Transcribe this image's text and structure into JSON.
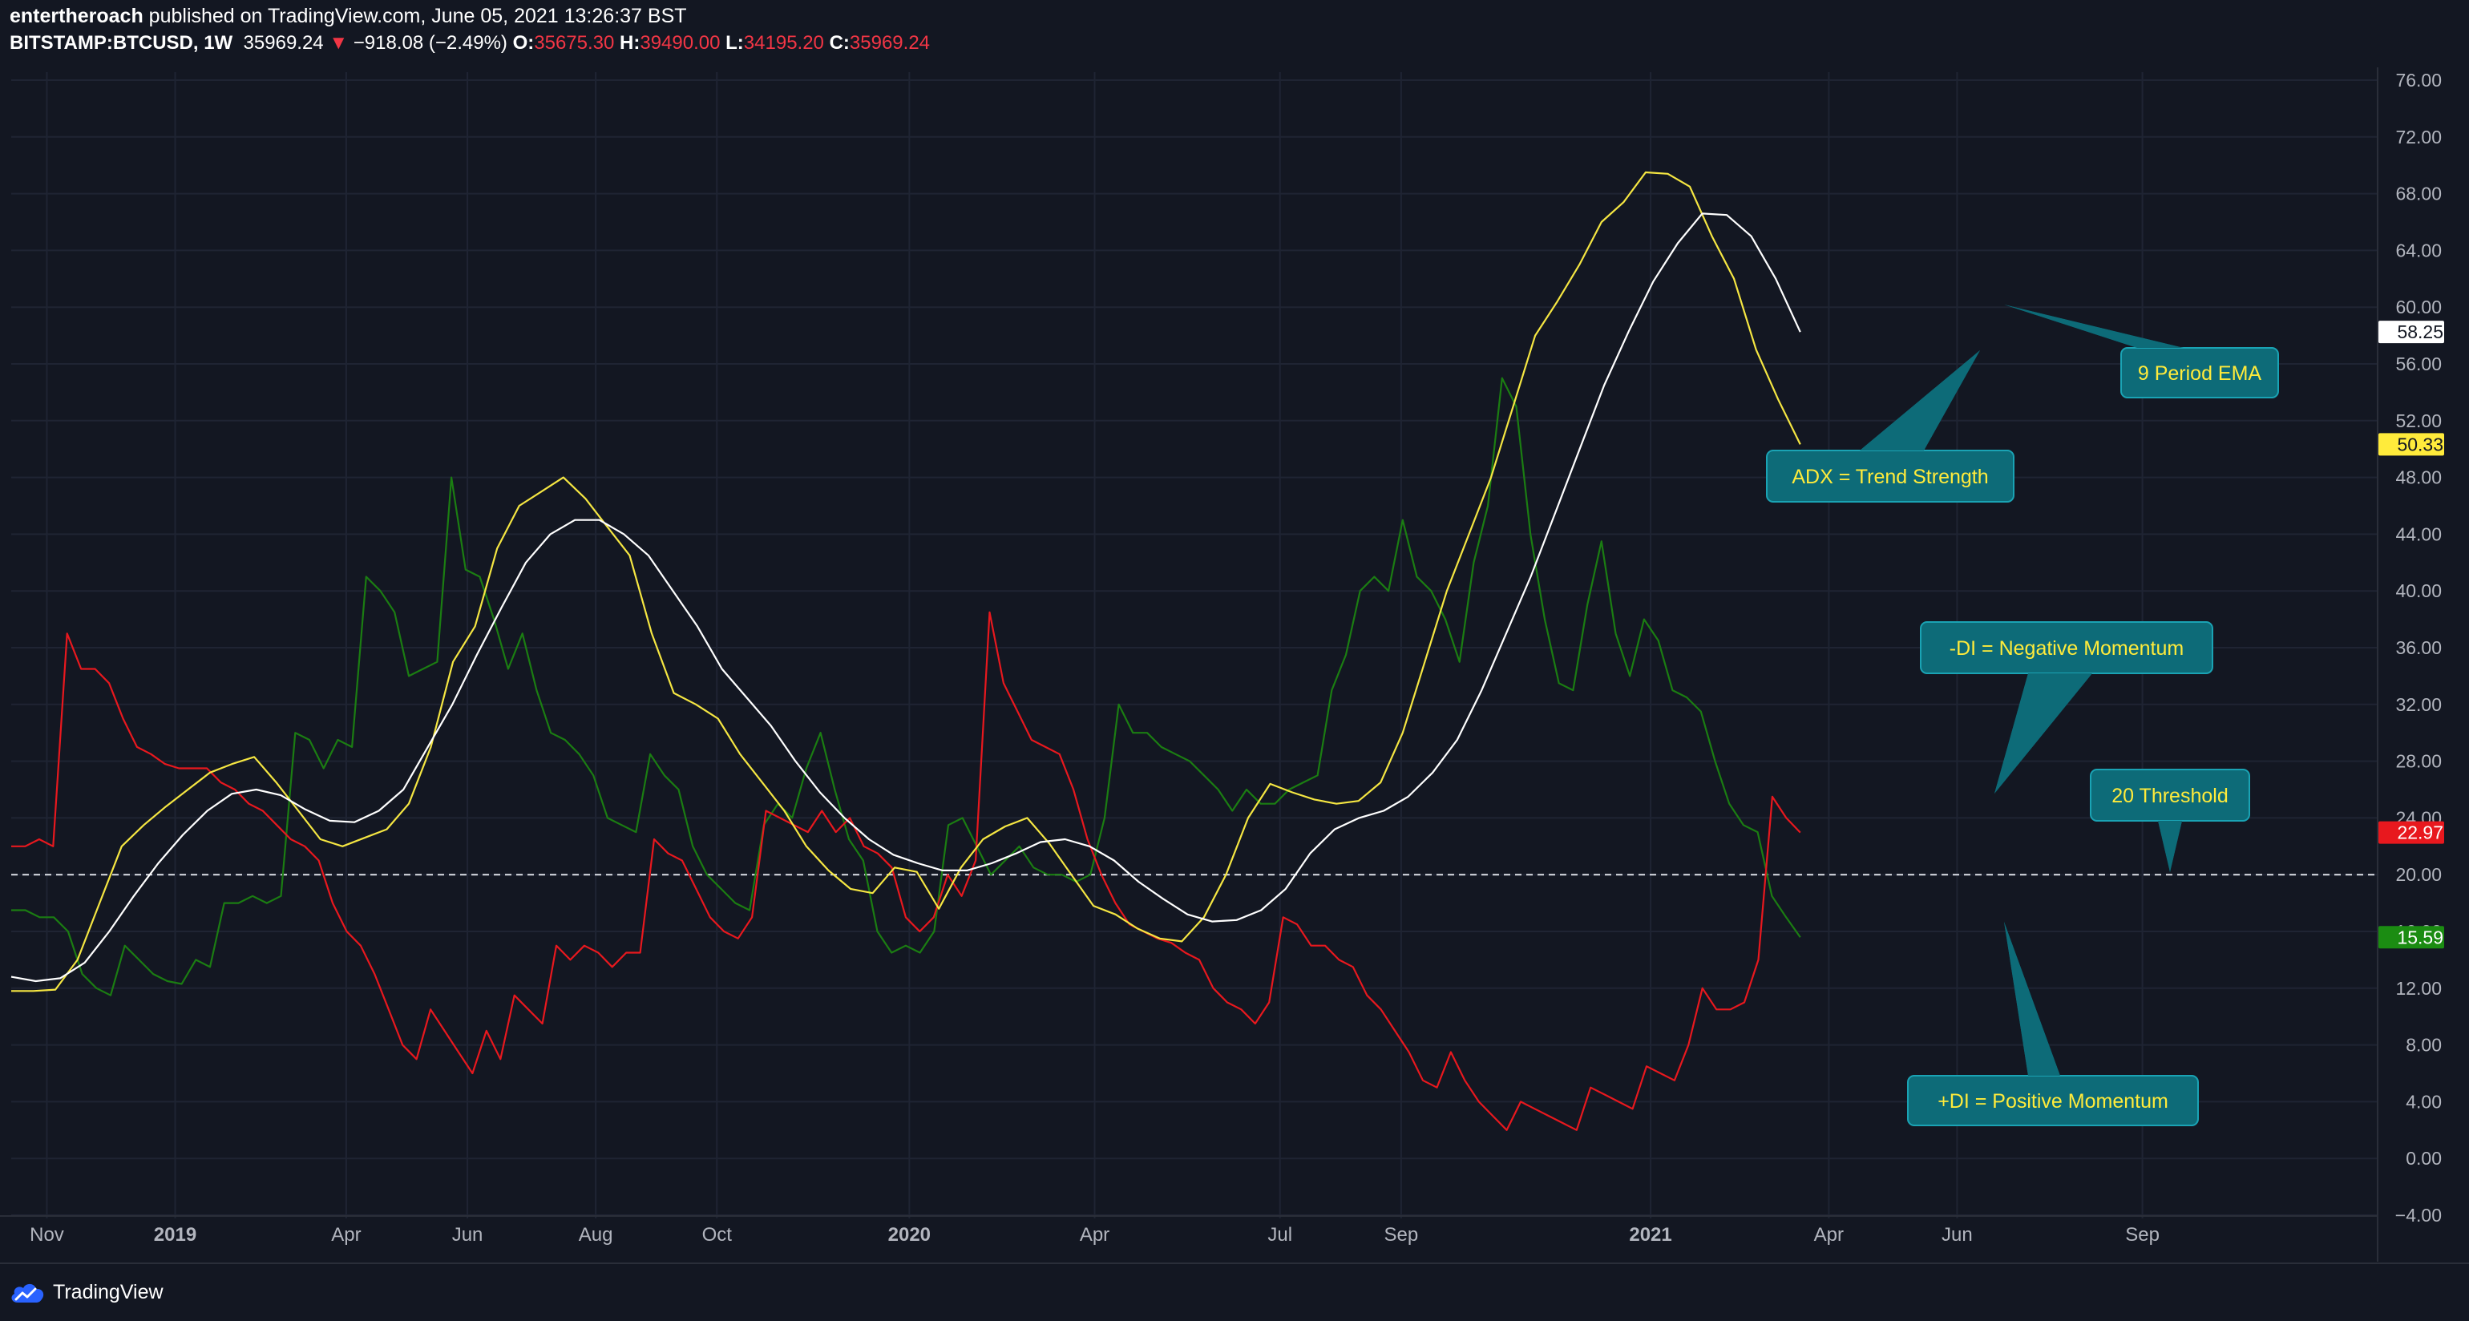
{
  "header": {
    "author": "entertheroach",
    "published_text": "published on TradingView.com, June 05, 2021 13:26:37 BST",
    "symbol": "BITSTAMP:BTCUSD, 1W",
    "last_price": "35969.24",
    "change_arrow": "▼",
    "change": "−918.08 (−2.49%)",
    "open_label": "O:",
    "open": "35675.30",
    "high_label": "H:",
    "high": "39490.00",
    "low_label": "L:",
    "low": "34195.20",
    "close_label": "C:",
    "close": "35969.24"
  },
  "brand": {
    "label": "TradingView"
  },
  "colors": {
    "background": "#131722",
    "grid": "#1f2433",
    "adx": "#f5e642",
    "ema": "#ffffff",
    "minus_di": "#e8181e",
    "plus_di": "#1b7d12",
    "annotation_bg": "#0d6b78",
    "annotation_border": "#1aa3b4",
    "annotation_text": "#ffeb3b"
  },
  "chart_data": {
    "type": "line",
    "ylim": [
      -4,
      76
    ],
    "xlim": [
      0,
      166
    ],
    "y_ticks": [
      "76.00",
      "72.00",
      "68.00",
      "64.00",
      "60.00",
      "56.00",
      "52.00",
      "48.00",
      "44.00",
      "40.00",
      "36.00",
      "32.00",
      "28.00",
      "24.00",
      "20.00",
      "16.00",
      "12.00",
      "8.00",
      "4.00",
      "0.00",
      "−4.00"
    ],
    "x_ticks": [
      {
        "x": 2.5,
        "label": "Nov",
        "bold": false
      },
      {
        "x": 11.5,
        "label": "2019",
        "bold": true
      },
      {
        "x": 23.5,
        "label": "Apr",
        "bold": false
      },
      {
        "x": 32,
        "label": "Jun",
        "bold": false
      },
      {
        "x": 41,
        "label": "Aug",
        "bold": false
      },
      {
        "x": 49.5,
        "label": "Oct",
        "bold": false
      },
      {
        "x": 63,
        "label": "2020",
        "bold": true
      },
      {
        "x": 76,
        "label": "Apr",
        "bold": false
      },
      {
        "x": 89,
        "label": "Jul",
        "bold": false
      },
      {
        "x": 97.5,
        "label": "Sep",
        "bold": false
      },
      {
        "x": 115,
        "label": "2021",
        "bold": true
      },
      {
        "x": 127.5,
        "label": "Apr",
        "bold": false
      },
      {
        "x": 136.5,
        "label": "Jun",
        "bold": false
      },
      {
        "x": 149.5,
        "label": "Sep",
        "bold": false
      }
    ],
    "threshold": 20,
    "series": [
      {
        "name": "ADX",
        "key": "adx",
        "last_label": "50.33",
        "values": [
          11.8,
          11.8,
          11.9,
          14,
          18,
          22,
          23.5,
          24.8,
          26,
          27.2,
          27.8,
          28.3,
          26.5,
          24.5,
          22.5,
          22,
          22.6,
          23.2,
          25,
          29,
          35,
          37.5,
          43,
          46,
          47,
          48,
          46.5,
          44.5,
          42.5,
          37,
          32.8,
          32,
          31,
          28.5,
          26.5,
          24.5,
          22,
          20.3,
          19,
          18.7,
          20.5,
          20.2,
          17.6,
          20.5,
          22.5,
          23.4,
          24,
          22.2,
          20,
          17.8,
          17.2,
          16.2,
          15.5,
          15.3,
          17,
          20,
          24,
          26.4,
          25.8,
          25.3,
          25,
          25.2,
          26.5,
          30,
          35,
          40,
          44,
          48,
          53,
          58,
          60.4,
          63,
          66,
          67.4,
          69.5,
          69.4,
          68.5,
          65,
          62,
          57,
          53.5,
          50.33
        ]
      },
      {
        "name": "EMA",
        "key": "ema",
        "last_label": "58.25",
        "values": [
          12.8,
          12.5,
          12.7,
          13.8,
          16,
          18.5,
          20.8,
          22.8,
          24.5,
          25.7,
          26,
          25.6,
          24.6,
          23.8,
          23.7,
          24.5,
          26,
          29,
          32,
          35.5,
          38.8,
          42,
          44,
          45,
          45,
          44,
          42.5,
          40,
          37.5,
          34.5,
          32.5,
          30.5,
          28,
          25.8,
          24,
          22.5,
          21.4,
          20.8,
          20.3,
          20.3,
          20.8,
          21.5,
          22.3,
          22.5,
          22,
          21,
          19.5,
          18.3,
          17.2,
          16.7,
          16.8,
          17.5,
          19,
          21.5,
          23.2,
          24,
          24.5,
          25.5,
          27.2,
          29.5,
          33,
          37,
          41,
          45.5,
          50,
          54.5,
          58.3,
          61.8,
          64.5,
          66.6,
          66.5,
          65,
          62,
          58.25
        ]
      },
      {
        "name": "-DI",
        "key": "minus_di",
        "last_label": "22.97",
        "values": [
          22,
          22,
          22.5,
          22,
          37,
          34.5,
          34.5,
          33.5,
          31,
          29,
          28.5,
          27.8,
          27.5,
          27.5,
          27.5,
          26.5,
          26,
          25,
          24.5,
          23.5,
          22.5,
          22,
          21,
          18,
          16,
          15,
          13,
          10.5,
          8,
          7,
          10.5,
          9,
          7.5,
          6,
          9,
          7,
          11.5,
          10.5,
          9.5,
          15,
          14,
          15,
          14.5,
          13.5,
          14.5,
          14.5,
          22.5,
          21.5,
          21,
          19,
          17,
          16,
          15.5,
          17,
          24.5,
          24,
          23.5,
          23,
          24.5,
          23,
          24,
          22,
          21.5,
          20.5,
          17,
          16,
          17,
          20,
          18.5,
          21,
          38.5,
          33.5,
          31.5,
          29.5,
          29,
          28.5,
          26,
          22.5,
          20,
          18,
          16.5,
          16,
          15.5,
          15.2,
          14.5,
          14,
          12,
          11,
          10.5,
          9.5,
          11,
          17,
          16.5,
          15,
          15,
          14,
          13.5,
          11.5,
          10.5,
          9,
          7.5,
          5.5,
          5,
          7.5,
          5.5,
          4,
          3,
          2,
          4,
          3.5,
          3,
          2.5,
          2,
          5,
          4.5,
          4,
          3.5,
          6.5,
          6,
          5.5,
          8,
          12,
          10.5,
          10.5,
          11,
          14,
          25.5,
          24,
          22.97
        ]
      },
      {
        "name": "+DI",
        "key": "plus_di",
        "last_label": "15.59",
        "values": [
          17.5,
          17.5,
          17,
          17,
          16,
          13,
          12,
          11.5,
          15,
          14,
          13,
          12.5,
          12.3,
          14,
          13.5,
          18,
          18,
          18.5,
          18,
          18.5,
          30,
          29.5,
          27.5,
          29.5,
          29,
          41,
          40,
          38.5,
          34,
          34.5,
          35,
          48,
          41.5,
          41,
          38,
          34.5,
          37,
          33,
          30,
          29.5,
          28.5,
          27,
          24,
          23.5,
          23,
          28.5,
          27,
          26,
          22,
          20,
          19,
          18,
          17.5,
          23.5,
          25,
          24,
          27.5,
          30,
          26,
          22.5,
          21,
          16,
          14.5,
          15,
          14.5,
          16,
          23.5,
          24,
          22,
          20,
          21,
          22,
          20.5,
          20,
          20,
          19.5,
          20,
          24,
          32,
          30,
          30,
          29,
          28.5,
          28,
          27,
          26,
          24.5,
          26,
          25,
          25,
          26,
          26.5,
          27,
          33,
          35.5,
          40,
          41,
          40,
          45,
          41,
          40,
          38,
          35,
          42,
          46,
          55,
          53,
          44,
          38,
          33.5,
          33,
          39,
          43.5,
          37,
          34,
          38,
          36.5,
          33,
          32.5,
          31.5,
          28,
          25,
          23.5,
          23,
          18.5,
          17,
          15.59
        ]
      }
    ],
    "annotations": [
      {
        "key": "ema",
        "text": "9 Period EMA"
      },
      {
        "key": "adx",
        "text": "ADX = Trend Strength"
      },
      {
        "key": "minus_di",
        "text": "-DI = Negative Momentum"
      },
      {
        "key": "threshold",
        "text": "20 Threshold"
      },
      {
        "key": "plus_di",
        "text": "+DI = Positive Momentum"
      }
    ]
  }
}
